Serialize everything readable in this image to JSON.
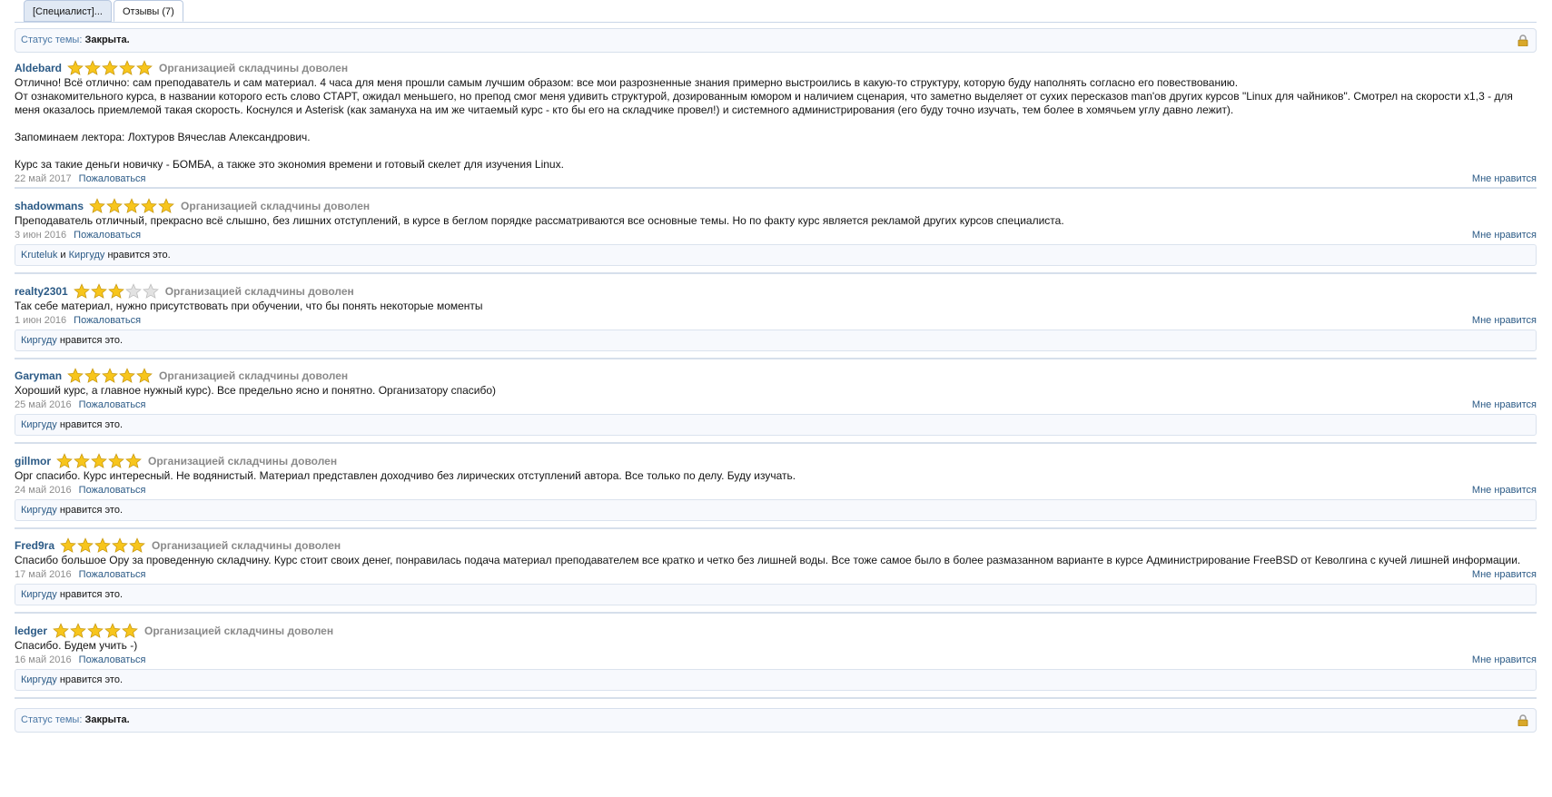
{
  "tabs": [
    {
      "label": "[Специалист]..."
    },
    {
      "label": "Отзывы (7)"
    }
  ],
  "status": {
    "label": "Статус темы:",
    "value": "Закрыта."
  },
  "colors": {
    "link": "#2b5a86",
    "star_fill": "#f7c51c",
    "star_empty": "#e2e2e2"
  },
  "reviews": [
    {
      "author": "Aldebard",
      "rating": 5,
      "verdict": "Организацией складчины доволен",
      "text": [
        "Отлично! Всё отлично: сам преподаватель и сам материал. 4 часа для меня прошли самым лучшим образом: все мои разрозненные знания примерно выстроились в какую-то структуру, которую буду наполнять согласно его повествованию.",
        "От ознакомительного курса, в названии которого есть слово СТАРТ, ожидал меньшего, но препод смог меня удивить структурой, дозированным юмором и наличием сценария, что заметно выделяет от сухих пересказов man'ов других курсов \"Linux для чайников\". Смотрел на скорости x1,3 - для меня оказалось приемлемой такая скорость. Коснулся и Asterisk (как замануха на им же читаемый курс - кто бы его на складчике провел!) и системного администрирования (его буду точно изучать, тем более в хомячьем углу давно лежит).",
        "",
        "Запоминаем лектора: Лохтуров Вячеслав Александрович.",
        "",
        "Курс за такие деньги новичку - БОМБА, а также это экономия времени и готовый скелет для изучения Linux."
      ],
      "date": "22 май 2017",
      "report": "Пожаловаться",
      "like": "Мне нравится",
      "likers": [],
      "likes_suffix": ""
    },
    {
      "author": "shadowmans",
      "rating": 5,
      "verdict": "Организацией складчины доволен",
      "text": [
        "Преподаватель отличный, прекрасно всё слышно, без лишних отступлений, в курсе в беглом порядке рассматриваются все основные темы. Но по факту курс является рекламой других курсов специалиста."
      ],
      "date": "3 июн 2016",
      "report": "Пожаловаться",
      "like": "Мне нравится",
      "likers": [
        "Kruteluk",
        "Киргуду"
      ],
      "likes_joiner": "и",
      "likes_suffix": "нравится это."
    },
    {
      "author": "realty2301",
      "rating": 3,
      "verdict": "Организацией складчины доволен",
      "text": [
        "Так себе материал, нужно присутствовать при обучении, что бы понять некоторые моменты"
      ],
      "date": "1 июн 2016",
      "report": "Пожаловаться",
      "like": "Мне нравится",
      "likers": [
        "Киргуду"
      ],
      "likes_suffix": "нравится это."
    },
    {
      "author": "Garyman",
      "rating": 5,
      "verdict": "Организацией складчины доволен",
      "text": [
        "Хороший курс, а главное нужный курс). Все предельно ясно и понятно. Организатору спасибо)"
      ],
      "date": "25 май 2016",
      "report": "Пожаловаться",
      "like": "Мне нравится",
      "likers": [
        "Киргуду"
      ],
      "likes_suffix": "нравится это."
    },
    {
      "author": "gillmor",
      "rating": 5,
      "verdict": "Организацией складчины доволен",
      "text": [
        "Орг спасибо. Курс интересный. Не водянистый. Материал представлен доходчиво без лирических отступлений автора. Все только по делу. Буду изучать."
      ],
      "date": "24 май 2016",
      "report": "Пожаловаться",
      "like": "Мне нравится",
      "likers": [
        "Киргуду"
      ],
      "likes_suffix": "нравится это."
    },
    {
      "author": "Fred9ra",
      "rating": 5,
      "verdict": "Организацией складчины доволен",
      "text": [
        "Спасибо большое Ору за проведенную складчину. Курс стоит своих денег, понравилась подача материал преподавателем все кратко и четко без лишней воды. Все тоже самое было в более размазанном варианте в курсе Администрирование FreeBSD от Кеволгина с кучей лишней информации."
      ],
      "date": "17 май 2016",
      "report": "Пожаловаться",
      "like": "Мне нравится",
      "likers": [
        "Киргуду"
      ],
      "likes_suffix": "нравится это."
    },
    {
      "author": "ledger",
      "rating": 5,
      "verdict": "Организацией складчины доволен",
      "text": [
        "Спасибо. Будем учить -)"
      ],
      "date": "16 май 2016",
      "report": "Пожаловаться",
      "like": "Мне нравится",
      "likers": [
        "Киргуду"
      ],
      "likes_suffix": "нравится это."
    }
  ]
}
